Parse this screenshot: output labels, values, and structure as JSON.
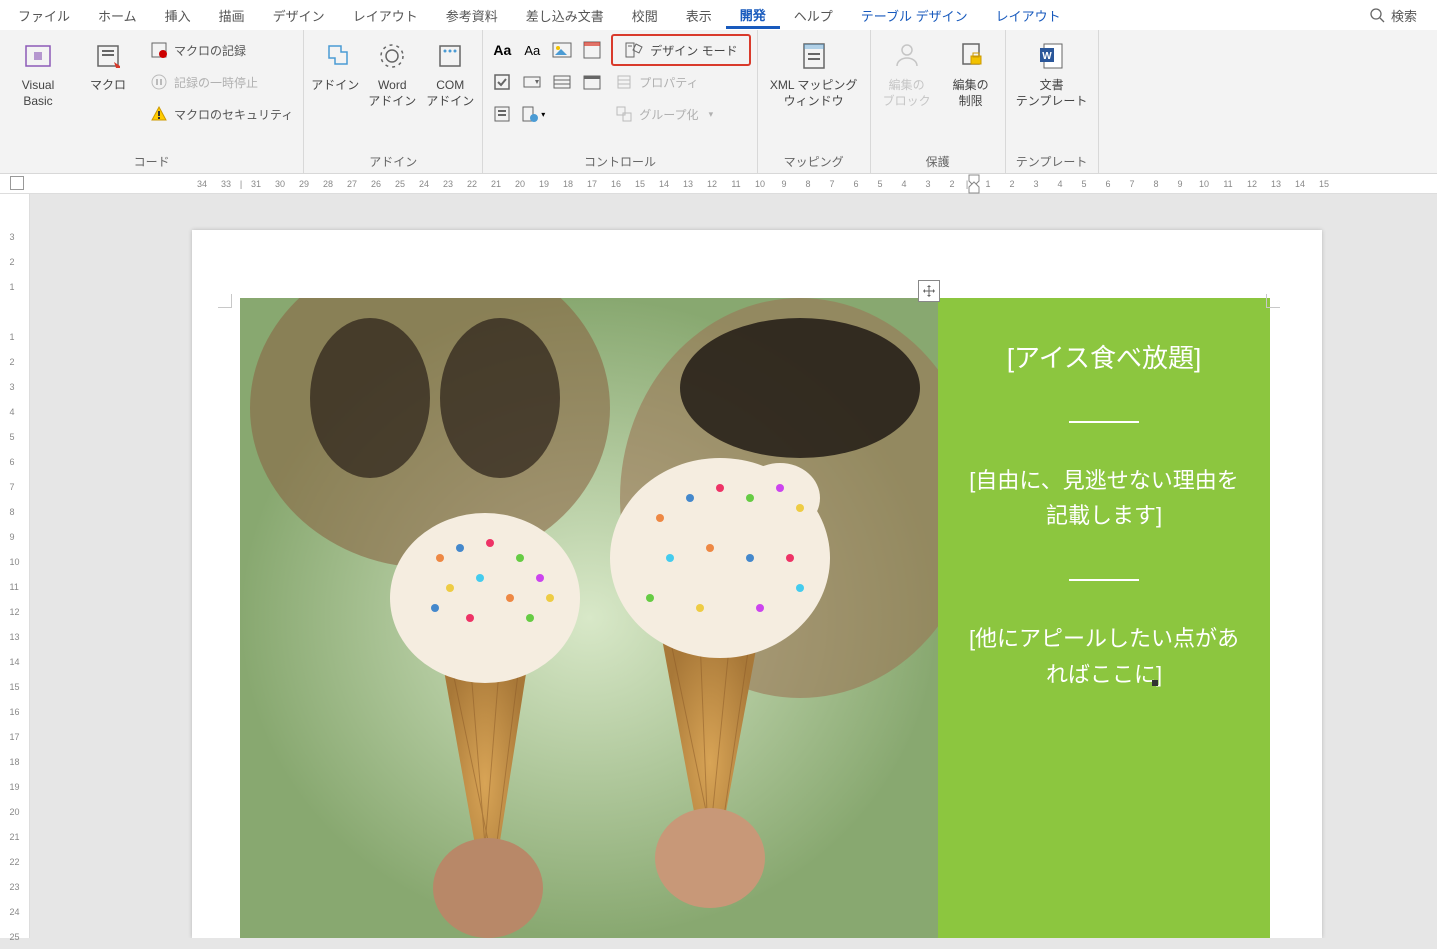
{
  "tabs": {
    "file": "ファイル",
    "home": "ホーム",
    "insert": "挿入",
    "draw": "描画",
    "design": "デザイン",
    "layout": "レイアウト",
    "references": "参考資料",
    "mailings": "差し込み文書",
    "review": "校閲",
    "view": "表示",
    "developer": "開発",
    "help": "ヘルプ",
    "table_design": "テーブル デザイン",
    "layout2": "レイアウト",
    "search": "検索"
  },
  "ribbon": {
    "code": {
      "visual_basic": "Visual Basic",
      "macros": "マクロ",
      "record_macro": "マクロの記録",
      "pause_recording": "記録の一時停止",
      "macro_security": "マクロのセキュリティ",
      "group": "コード"
    },
    "addins": {
      "addins": "アドイン",
      "word_addins": "Word\nアドイン",
      "com_addins": "COM\nアドイン",
      "group": "アドイン"
    },
    "controls": {
      "design_mode": "デザイン モード",
      "properties": "プロパティ",
      "group_ctrl": "グループ化",
      "group": "コントロール"
    },
    "mapping": {
      "xml_mapping": "XML マッピング\nウィンドウ",
      "group": "マッピング"
    },
    "protect": {
      "block": "編集の\nブロック",
      "restrict": "編集の\n制限",
      "group": "保護"
    },
    "template": {
      "doc_template": "文書\nテンプレート",
      "group": "テンプレート"
    }
  },
  "ruler_h": [
    "34",
    "33",
    "",
    "31",
    "30",
    "29",
    "28",
    "27",
    "26",
    "25",
    "24",
    "23",
    "22",
    "21",
    "20",
    "19",
    "18",
    "17",
    "16",
    "15",
    "14",
    "13",
    "12",
    "11",
    "10",
    "9",
    "8",
    "7",
    "6",
    "5",
    "4",
    "3",
    "2",
    "",
    "",
    "1",
    "2",
    "3",
    "4",
    "5",
    "6",
    "7",
    "8",
    "9",
    "10",
    "11",
    "12",
    "13",
    "14",
    "15"
  ],
  "ruler_v": [
    "3",
    "2",
    "1",
    "",
    "1",
    "2",
    "3",
    "4",
    "5",
    "6",
    "7",
    "8",
    "9",
    "10",
    "11",
    "12",
    "13",
    "14",
    "15",
    "16",
    "17",
    "18",
    "19",
    "20",
    "21",
    "22",
    "23",
    "24",
    "25"
  ],
  "doc": {
    "title": "[アイス食べ放題]",
    "subtitle": "[自由に、見逃せない理由を記載します]",
    "appeal": "[他にアピールしたい点があればここに]"
  }
}
